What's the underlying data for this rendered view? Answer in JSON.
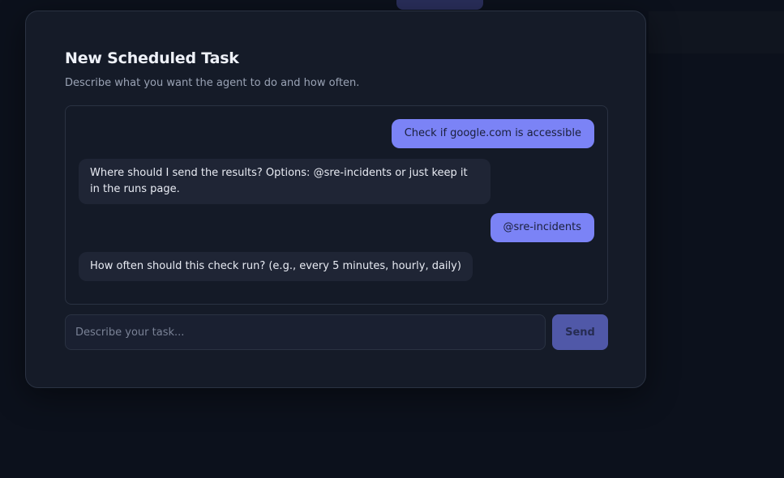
{
  "modal": {
    "title": "New Scheduled Task",
    "subtitle": "Describe what you want the agent to do and how often."
  },
  "chat": {
    "messages": [
      {
        "role": "user",
        "text": "Check if google.com is accessible"
      },
      {
        "role": "agent",
        "text": "Where should I send the results? Options: @sre-incidents or just keep it in the runs page."
      },
      {
        "role": "user",
        "text": "@sre-incidents"
      },
      {
        "role": "agent",
        "text": "How often should this check run? (e.g., every 5 minutes, hourly, daily)"
      }
    ]
  },
  "composer": {
    "placeholder": "Describe your task...",
    "value": "",
    "send_label": "Send"
  },
  "colors": {
    "accent": "#7b83f6",
    "send_button": "#5058a8",
    "modal_bg": "#151b28",
    "page_bg": "#0c111c"
  }
}
